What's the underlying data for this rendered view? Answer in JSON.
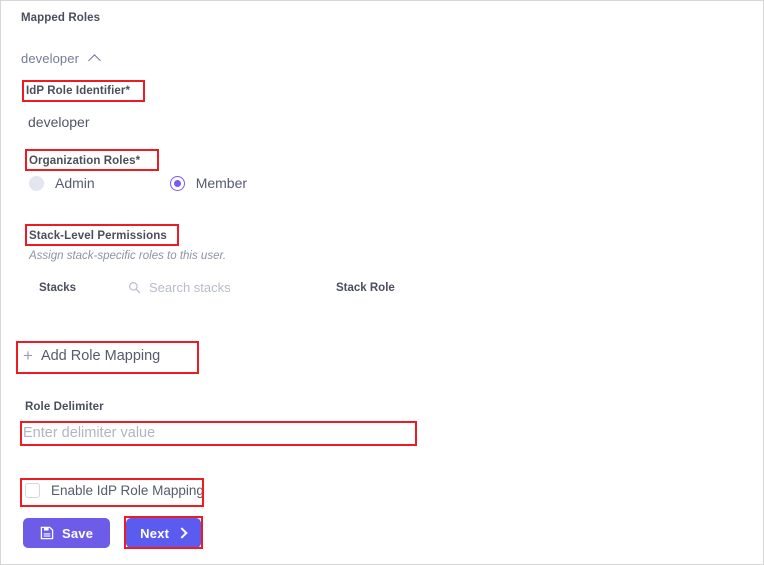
{
  "panel": {
    "title": "Mapped Roles"
  },
  "mapping_group": {
    "name": "developer",
    "toggle_icon": "chevron-up-icon",
    "idp_role": {
      "label": "IdP Role Identifier*",
      "value": "developer"
    },
    "org_roles": {
      "label": "Organization Roles*",
      "options": [
        {
          "label": "Admin",
          "selected": false
        },
        {
          "label": "Member",
          "selected": true
        }
      ]
    },
    "stack_permissions": {
      "label": "Stack-Level Permissions",
      "help": "Assign stack-specific roles to this user.",
      "columns": {
        "stacks": "Stacks",
        "stack_role": "Stack Role"
      },
      "search": {
        "placeholder": "Search stacks",
        "value": "",
        "icon": "search-icon"
      }
    }
  },
  "add_role_mapping": {
    "label": "Add Role Mapping",
    "icon": "plus-icon"
  },
  "role_delimiter": {
    "label": "Role Delimiter",
    "placeholder": "Enter delimiter value",
    "value": ""
  },
  "enable_mapping": {
    "label": "Enable IdP Role Mapping",
    "checked": false
  },
  "footer": {
    "save_label": "Save",
    "save_icon": "save-floppy-icon",
    "next_label": "Next",
    "next_icon": "chevron-right-icon"
  },
  "colors": {
    "annotation": "#ed1c24",
    "save_button": "#6c5ce7",
    "next_button": "#5b5bef",
    "radio_selected": "#7a5cf0",
    "label_text": "#4a4f5e",
    "body_text": "#565b6d",
    "placeholder": "#b0b5c4"
  }
}
